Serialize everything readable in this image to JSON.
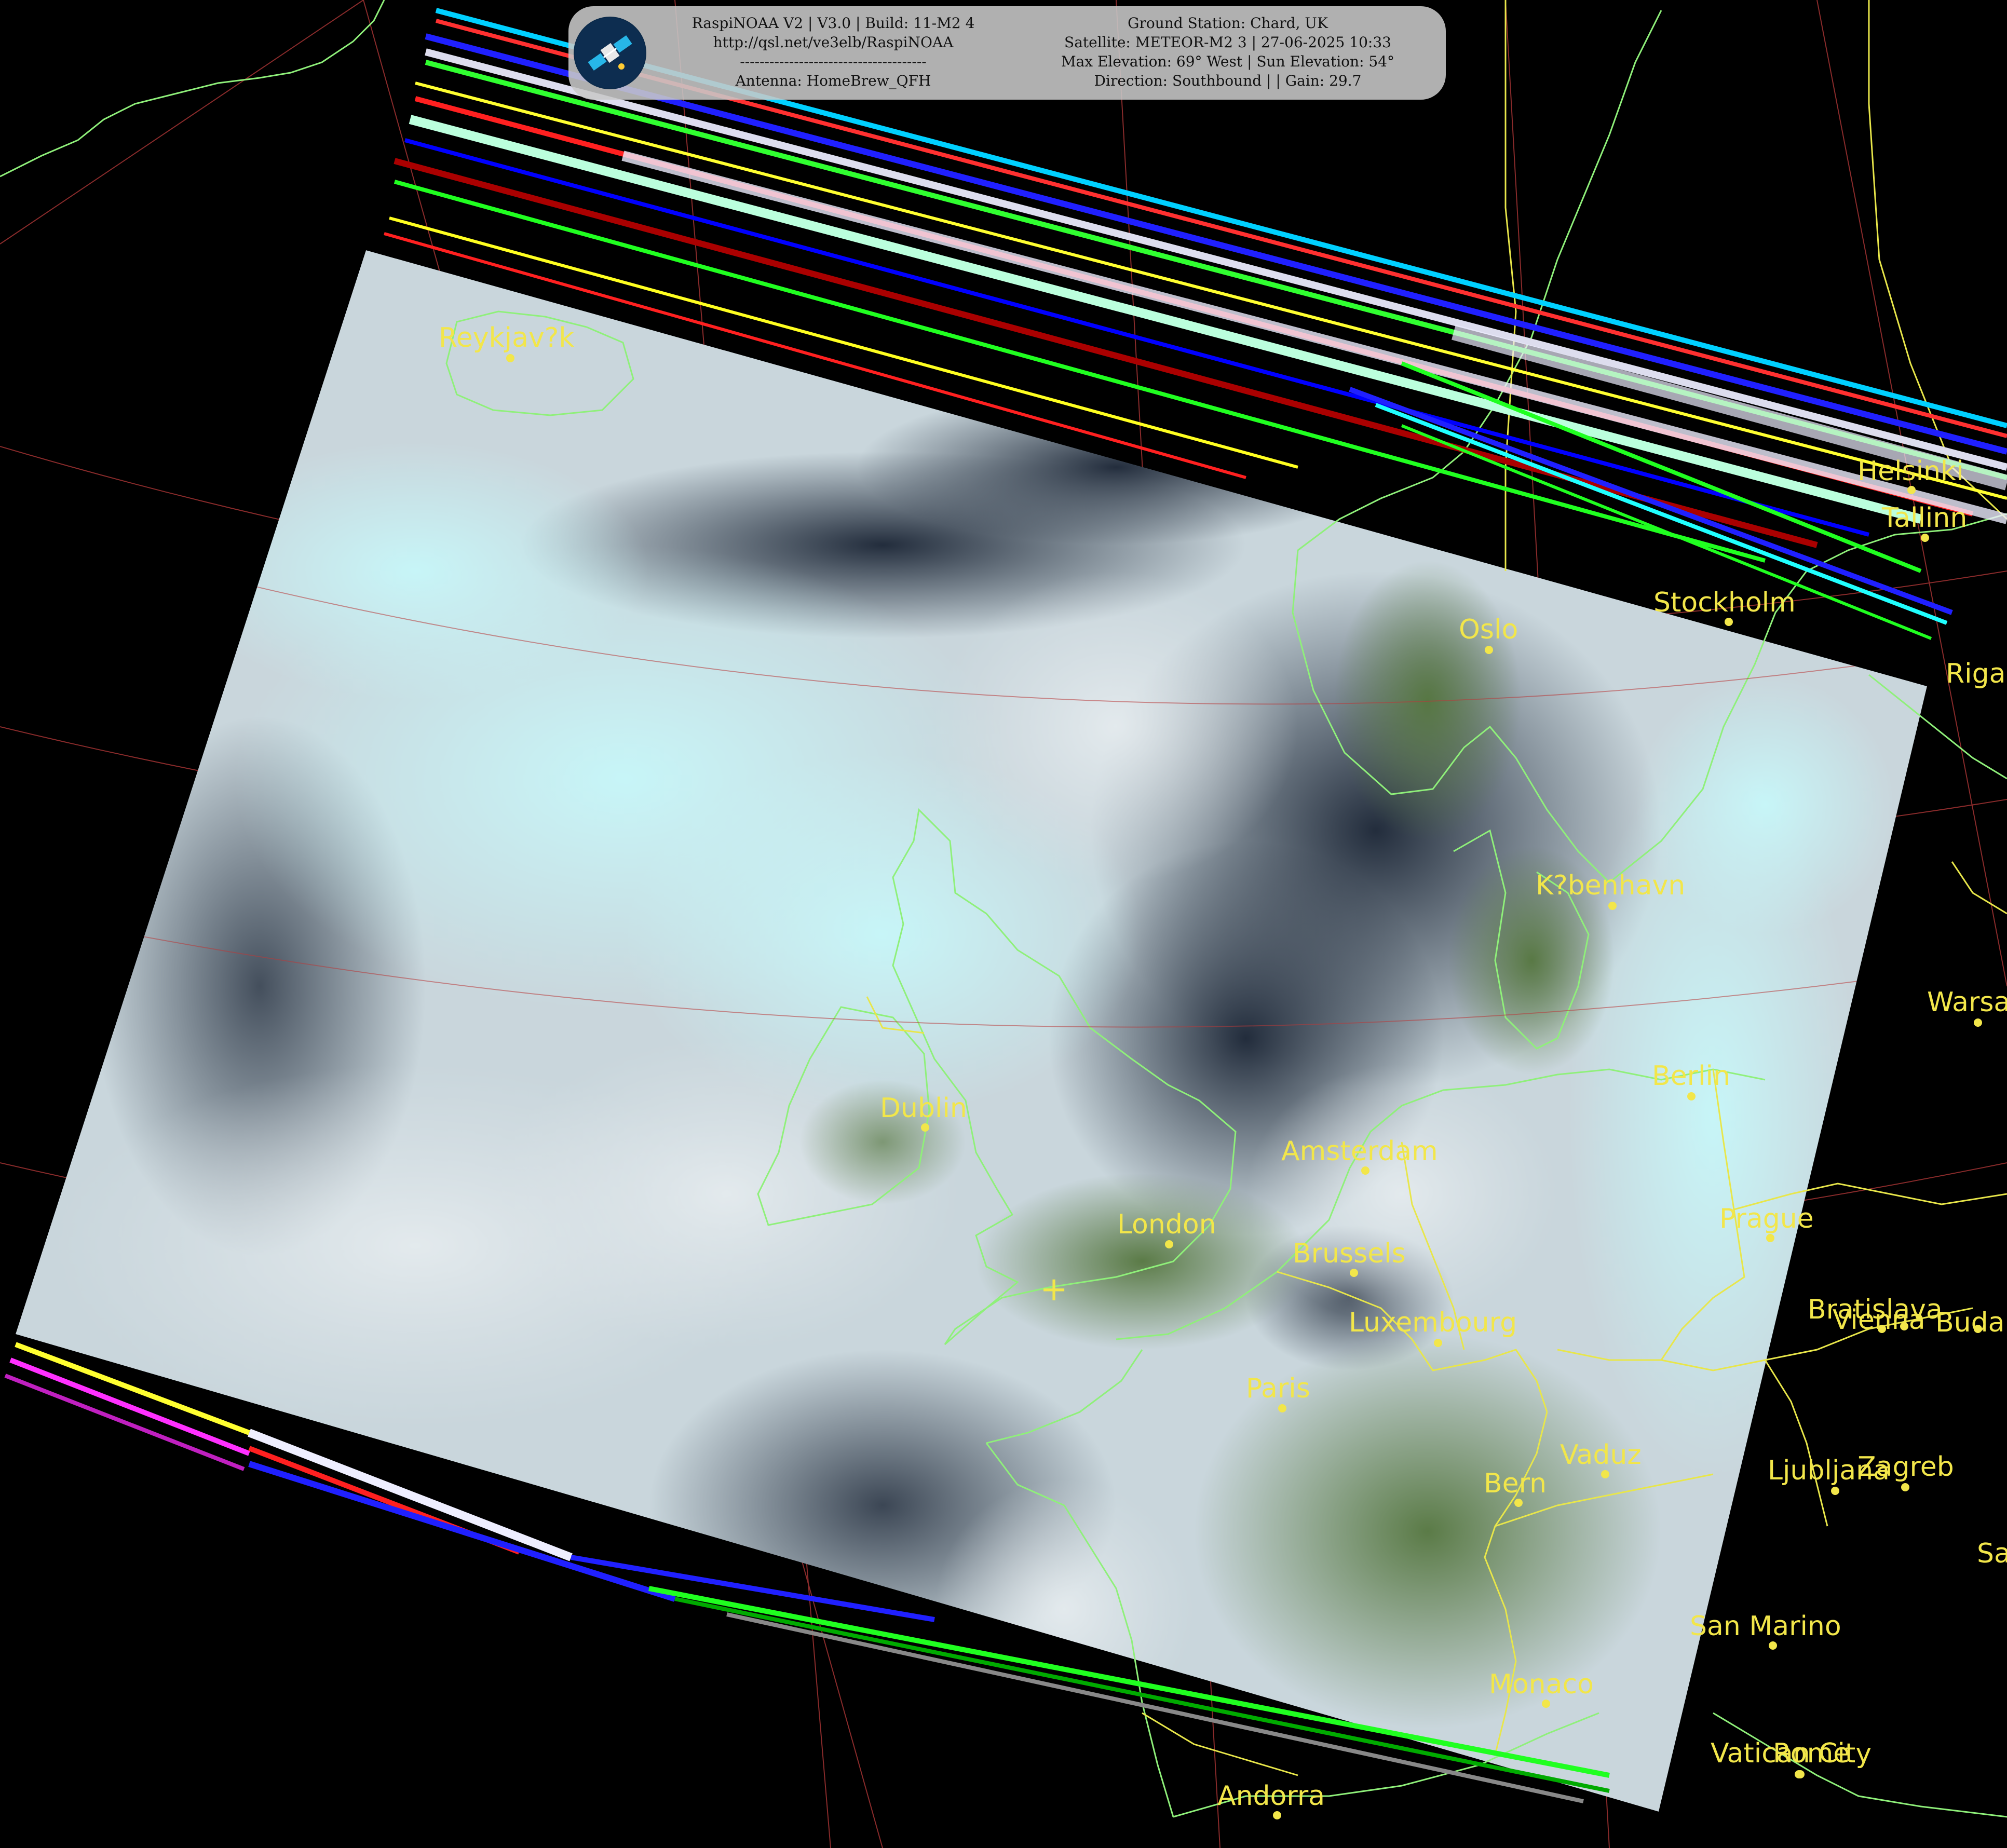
{
  "header": {
    "left": [
      "RaspiNOAA V2 | V3.0 | Build: 11-M2 4",
      "http://qsl.net/ve3elb/RaspiNOAA",
      "--------------------------------------",
      "Antenna: HomeBrew_QFH"
    ],
    "right": [
      "Ground Station: Chard, UK",
      "Satellite: METEOR-M2 3 | 27-06-2025 10:33",
      "Max Elevation: 69° West | Sun Elevation: 54°",
      "Direction: Southbound | | Gain: 29.7"
    ],
    "logo_icon": "satellite-icon"
  },
  "ground_station_marker": "+",
  "cities": [
    "Reykjav?k",
    "Helsinki",
    "Tallinn",
    "Stockholm",
    "Oslo",
    "Riga",
    "K?benhavn",
    "Warsa",
    "Berlin",
    "Dublin",
    "Amsterdam",
    "London",
    "Brussels",
    "Prague",
    "Luxembourg",
    "Bratislava",
    "Vienna",
    "Buda",
    "Paris",
    "Vaduz",
    "Bern",
    "Ljubljana",
    "Zagreb",
    "Sa",
    "San Marino",
    "Monaco",
    "Vatican City",
    "Rome",
    "Andorra"
  ],
  "colors": {
    "label": "#f2e64a",
    "coast": "#8ff07a",
    "border": "#e8e64a",
    "grid": "#b83a3a",
    "cloud": "#bfeff2",
    "sea": "#1b2535",
    "land": "#4a6a3a"
  }
}
